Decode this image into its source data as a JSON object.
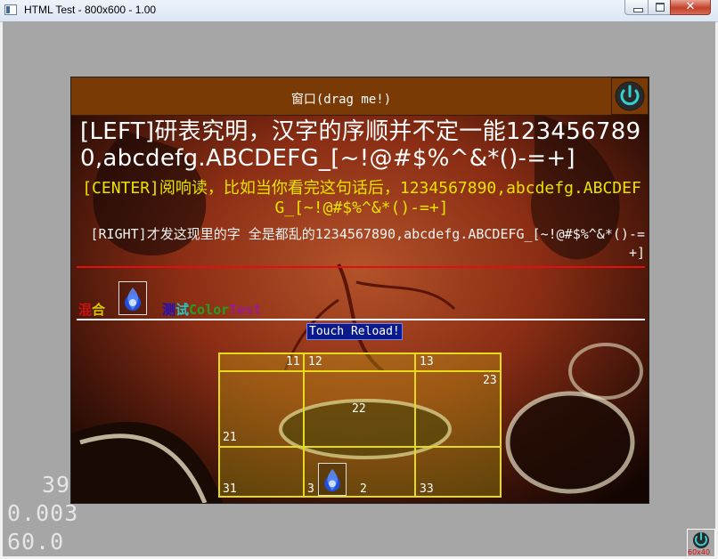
{
  "window": {
    "title": "HTML Test - 800x600 - 1.00",
    "close_glyph": "✕"
  },
  "panel": {
    "title": "窗口(drag me!)"
  },
  "text": {
    "left": "[LEFT]研表究明，汉字的序顺并不定一能1234567890,abcdefg.ABCDEFG_[~!@#$%^&*()-=+]",
    "center": "[CENTER]阅响读，比如当你看完这句话后，1234567890,abcdefg.ABCDEFG_[~!@#$%^&*()-=+]",
    "right": "[RIGHT]才发这现里的字 全是都乱的1234567890,abcdefg.ABCDEFG_[~!@#$%^&*()-=+]"
  },
  "mixed": {
    "hun": "混",
    "he": "合",
    "ce": "测",
    "shi": "试",
    "color": "Color",
    "test": "Test",
    "colors": {
      "hun": "#cc1010",
      "he": "#d8c800",
      "ce": "#2010c0",
      "shi": "#20c8c8",
      "color": "#20a020",
      "test": "#a01890"
    }
  },
  "reload_label": "Touch Reload!",
  "grid": {
    "labels": [
      "11",
      "12",
      "13",
      "21",
      "22",
      "23",
      "31",
      "3",
      "2",
      "33"
    ]
  },
  "stats": {
    "fps": "39",
    "frame_time": "0.003",
    "target_fps": "60.0"
  },
  "corner": {
    "label": "60x40"
  },
  "icons": {
    "power": "power-icon",
    "flame": "blue-flame-icon"
  }
}
